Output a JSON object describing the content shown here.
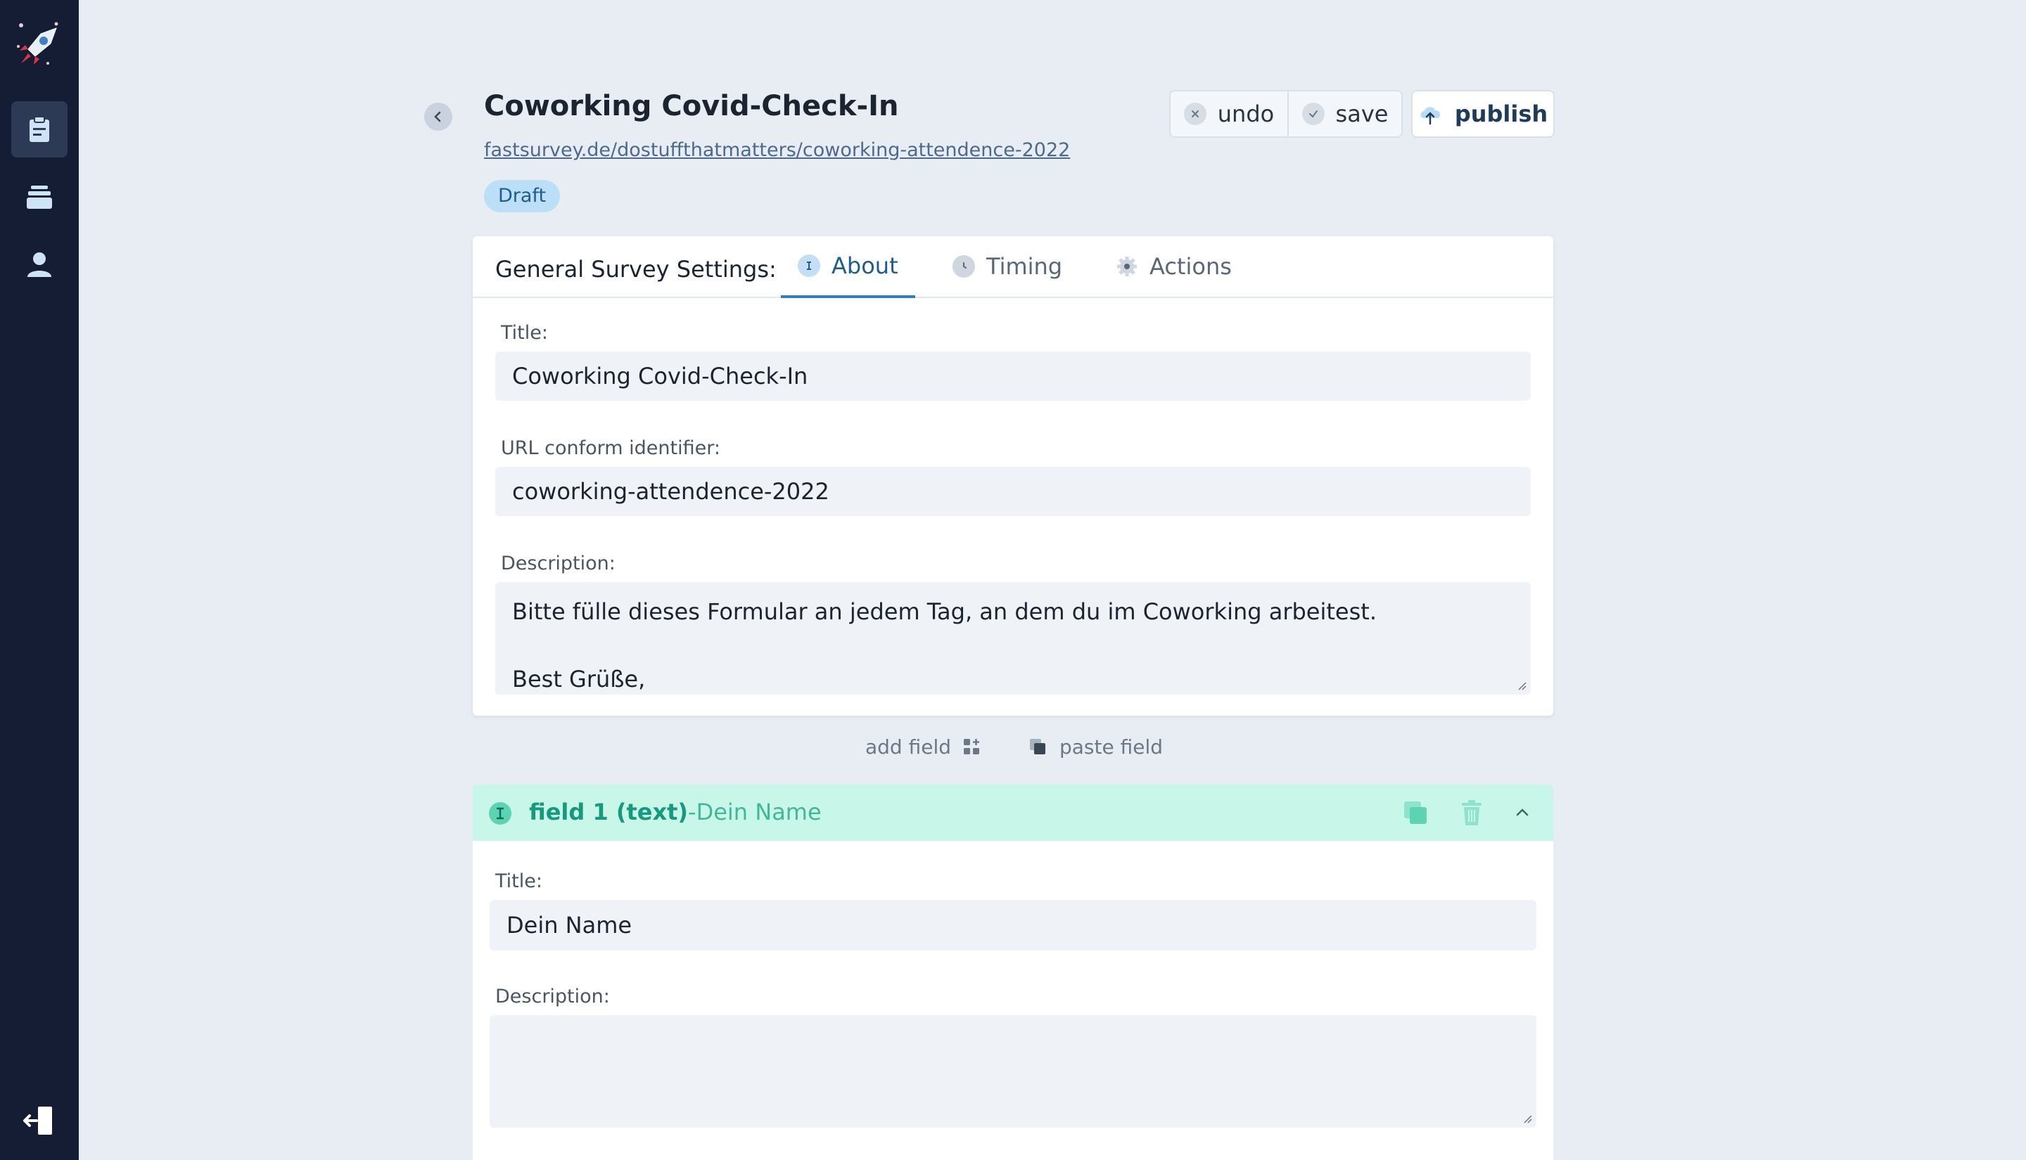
{
  "header": {
    "title": "Coworking Covid-Check-In",
    "link": "fastsurvey.de/dostuffthatmatters/coworking-attendence-2022",
    "status": "Draft"
  },
  "toolbar": {
    "undo_label": "undo",
    "save_label": "save",
    "publish_label": "publish"
  },
  "settings": {
    "heading": "General Survey Settings:",
    "tabs": [
      {
        "label": "About",
        "icon": "text-cursor-icon",
        "active": true
      },
      {
        "label": "Timing",
        "icon": "clock-icon",
        "active": false
      },
      {
        "label": "Actions",
        "icon": "gear-icon",
        "active": false
      }
    ],
    "title_label": "Title:",
    "title_value": "Coworking Covid-Check-In",
    "identifier_label": "URL conform identifier:",
    "identifier_value": "coworking-attendence-2022",
    "description_label": "Description:",
    "description_line1": "Bitte fülle dieses Formular an jedem Tag, an dem du im Coworking arbeitest.",
    "description_line2": "Best Grüße,"
  },
  "actions": {
    "add_field": "add field",
    "paste_field": "paste field"
  },
  "field1": {
    "heading_strong": "field 1 (text)",
    "heading_sub": "-Dein Name",
    "title_label": "Title:",
    "title_value": "Dein Name",
    "description_label": "Description:",
    "description_value": ""
  },
  "colors": {
    "sidebar": "#141d33",
    "accent": "#2f7fc1",
    "field_header": "#c8f7ea",
    "field_accent": "#159a7d"
  }
}
